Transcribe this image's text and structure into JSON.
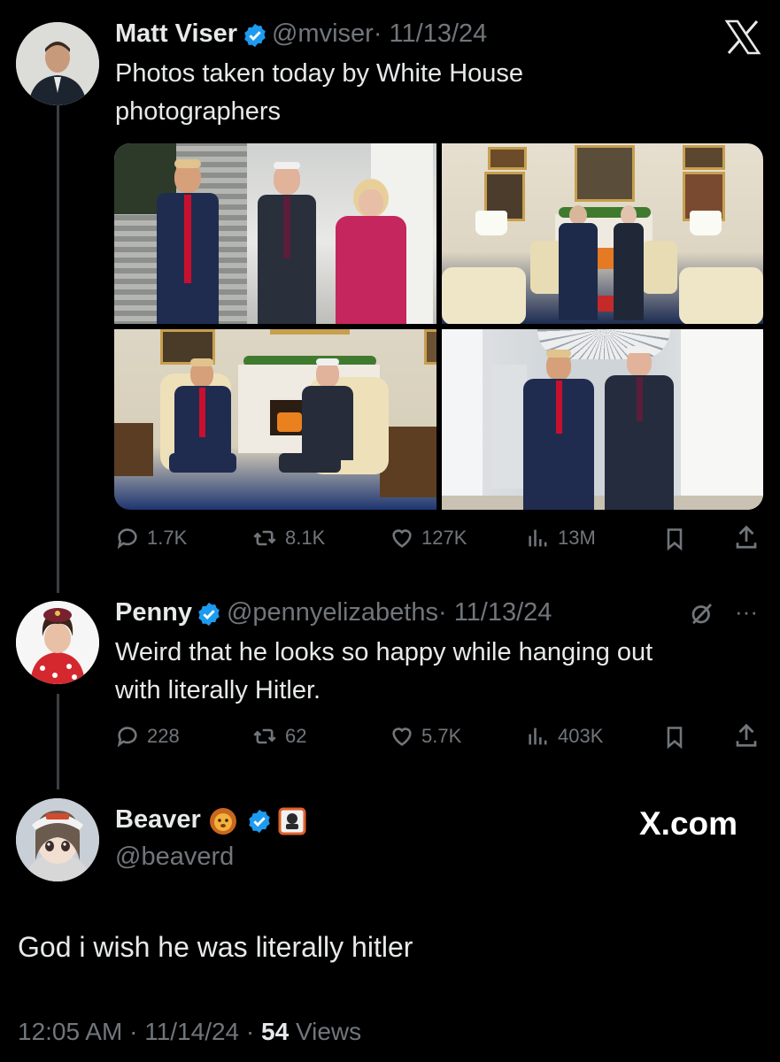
{
  "logo": "X",
  "tweet1": {
    "name": "Matt Viser",
    "handle": "@mviser",
    "date": "· 11/13/24",
    "text_line1": "Photos taken today by White House",
    "text_line2": "photographers",
    "stats": {
      "replies": "1.7K",
      "reposts": "8.1K",
      "likes": "127K",
      "views": "13M"
    }
  },
  "tweet2": {
    "name": "Penny",
    "handle": "@pennyelizabeths",
    "date": "· 11/13/24",
    "text_line1": "Weird that he looks so happy while hanging out",
    "text_line2": "with literally Hitler.",
    "stats": {
      "replies": "228",
      "reposts": "62",
      "likes": "5.7K",
      "views": "403K"
    },
    "more": "···"
  },
  "tweet3": {
    "name": "Beaver",
    "handle": "@beaverd",
    "text": "God i wish he was literally hitler",
    "time": "12:05 AM",
    "date": "· 11/14/24 ·",
    "views_count": "54",
    "views_label": "Views"
  },
  "watermark": "X.com",
  "colors": {
    "background": "#000000",
    "text": "#e7e9ea",
    "muted": "#71767b",
    "verified": "#1d9bf0"
  }
}
